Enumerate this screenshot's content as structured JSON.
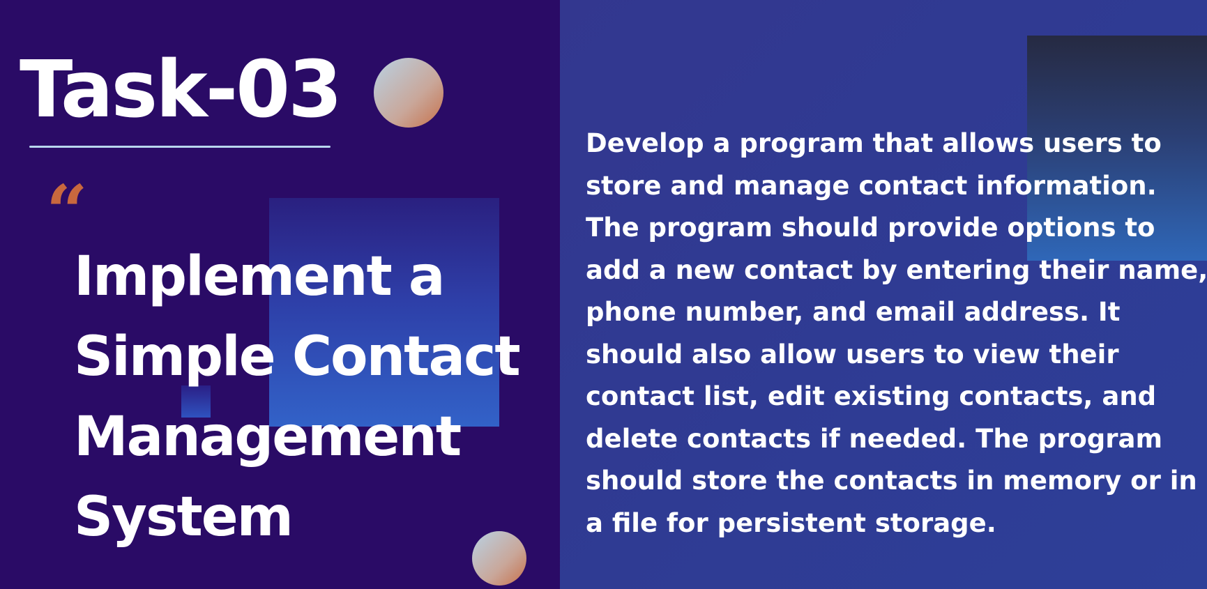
{
  "title": "Task-03",
  "quote_mark": "“",
  "headline_lines": [
    "Implement a",
    "Simple Contact",
    "Management",
    "System"
  ],
  "description": "Develop a program that allows users to\nstore and manage contact information.\nThe program should provide options to\nadd a new contact by entering their name,\nphone number, and email address. It\nshould also allow users to view their\ncontact list, edit existing contacts, and\ndelete contacts if needed. The program\nshould store the contacts in memory or in\na file for persistent storage.",
  "colors": {
    "left_background": "#2a0b66",
    "right_background": "#30398f",
    "accent_quote": "#c8683e",
    "underline": "#b8d6ee",
    "text": "#ffffff"
  }
}
